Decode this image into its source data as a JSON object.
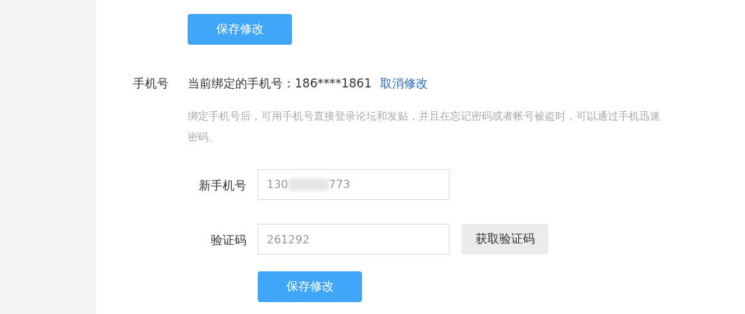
{
  "top_button": "保存修改",
  "phone": {
    "label": "手机号",
    "current_text": "当前绑定的手机号：186****1861",
    "cancel_link": "取消修改",
    "description_lines": [
      "绑定手机号后，可用手机号直接登录论坛和发贴，并且在忘记密码或者帐号被盗时，可以通过手机迅速",
      "密码。"
    ]
  },
  "new_phone": {
    "label": "新手机号",
    "value_start": "130",
    "value_end": "773"
  },
  "code": {
    "label": "验证码",
    "value": "261292",
    "button": "获取验证码"
  },
  "save_button": "保存修改"
}
